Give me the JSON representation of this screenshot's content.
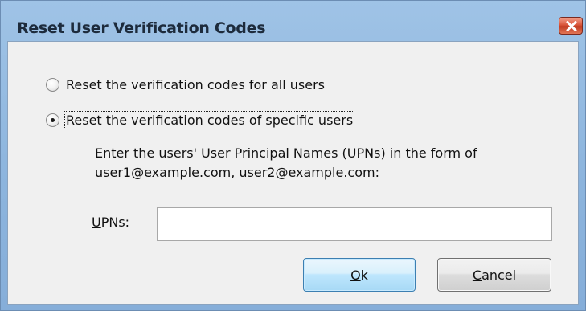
{
  "window": {
    "title": "Reset User Verification Codes"
  },
  "options": [
    {
      "label": "Reset the verification codes for all users",
      "checked": false
    },
    {
      "label": "Reset the verification codes of specific users",
      "checked": true
    }
  ],
  "instructions": {
    "line1": "Enter the users' User Principal Names (UPNs) in the form of",
    "line2": "user1@example.com, user2@example.com:"
  },
  "upns": {
    "label_mnemonic": "U",
    "label_rest": "PNs:",
    "value": ""
  },
  "buttons": {
    "ok_mnemonic": "O",
    "ok_rest": "k",
    "cancel_mnemonic": "C",
    "cancel_rest": "ancel"
  },
  "icons": {
    "close": "close-icon",
    "radio": "radio-icon"
  },
  "colors": {
    "titlebar": "#9fc3e6",
    "close_button": "#d9553a",
    "client_bg": "#f0f0f0",
    "default_button_border": "#3c7fb1"
  }
}
